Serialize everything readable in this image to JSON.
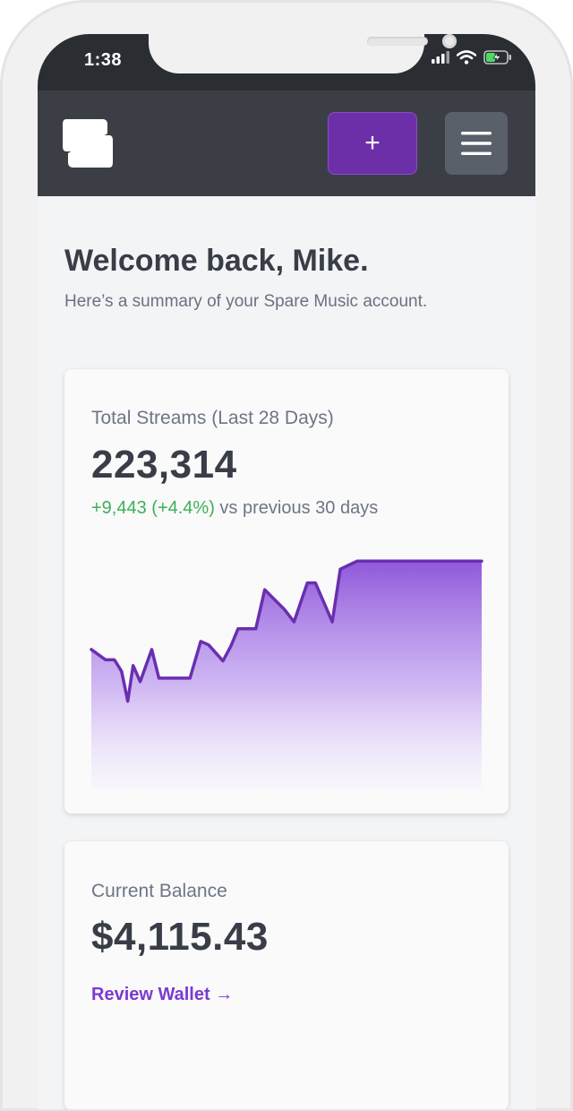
{
  "status_bar": {
    "time": "1:38",
    "icons": [
      "cellular-signal-icon",
      "wifi-icon",
      "battery-charging-icon"
    ]
  },
  "header": {
    "logo": "spare-logo",
    "add_label": "+",
    "menu_icon": "hamburger-icon"
  },
  "welcome": {
    "title": "Welcome back, Mike.",
    "subtitle": "Here’s a summary of your Spare Music account."
  },
  "streams_card": {
    "label": "Total Streams (Last 28 Days)",
    "value": "223,314",
    "change": "+9,443 (+4.4%)",
    "change_suffix": " vs previous 30 days"
  },
  "balance_card": {
    "label": "Current Balance",
    "value": "$4,115.43",
    "link": "Review Wallet →"
  },
  "colors": {
    "accent": "#6c2fa8",
    "positive": "#3cb05a",
    "chart_line": "#6a2fb0",
    "header_bg": "#3b3f45"
  },
  "chart_data": {
    "type": "area",
    "x": [
      1,
      2,
      3,
      4,
      5,
      6,
      7,
      8,
      9,
      10,
      11,
      12,
      13,
      14,
      15,
      16,
      17,
      18,
      19,
      20,
      21,
      22,
      23,
      24,
      25,
      26,
      27,
      28,
      29,
      30,
      31,
      32,
      33,
      34,
      35,
      36,
      37,
      38
    ],
    "values": [
      48,
      39,
      39,
      29,
      3,
      34,
      20,
      48,
      23,
      23,
      23,
      55,
      52,
      38,
      51,
      66,
      66,
      100,
      83,
      72,
      106,
      106,
      72,
      118,
      125,
      125,
      125,
      125,
      125,
      125,
      125,
      125,
      125,
      125,
      125,
      125,
      125,
      125
    ],
    "points": [
      [
        0,
        48
      ],
      [
        16,
        39
      ],
      [
        26,
        39
      ],
      [
        34,
        29
      ],
      [
        41,
        3
      ],
      [
        47,
        34
      ],
      [
        55,
        20
      ],
      [
        68,
        48
      ],
      [
        76,
        23
      ],
      [
        97,
        23
      ],
      [
        111,
        23
      ],
      [
        123,
        55
      ],
      [
        132,
        52
      ],
      [
        148,
        38
      ],
      [
        157,
        51
      ],
      [
        165,
        66
      ],
      [
        185,
        66
      ],
      [
        195,
        100
      ],
      [
        217,
        83
      ],
      [
        228,
        72
      ],
      [
        243,
        106
      ],
      [
        252,
        106
      ],
      [
        271,
        72
      ],
      [
        280,
        118
      ],
      [
        299,
        125
      ],
      [
        439,
        125
      ]
    ],
    "ylim": [
      -73,
      147
    ],
    "xlim": [
      0,
      439
    ]
  }
}
